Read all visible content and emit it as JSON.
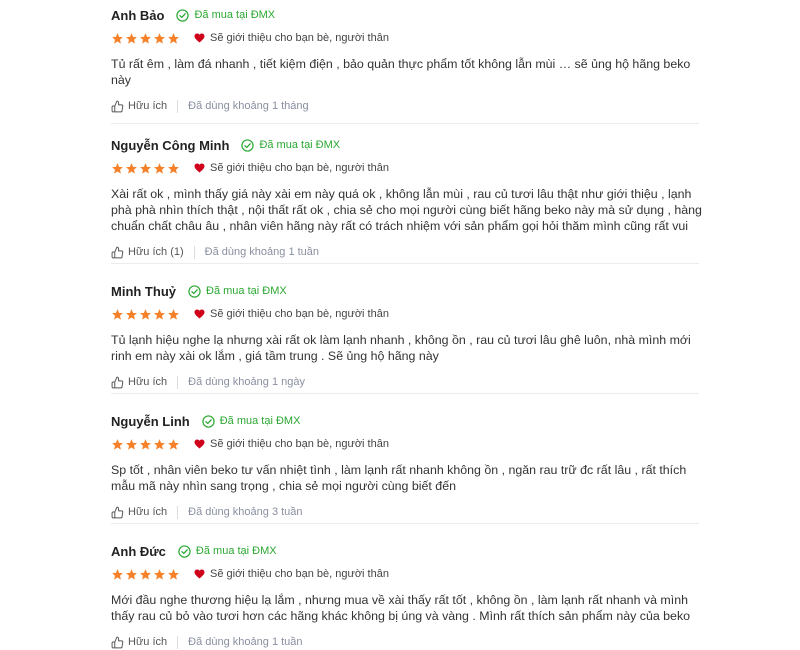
{
  "colors": {
    "star": "#f5822a",
    "heart": "#d0021b",
    "verified": "#2ba832",
    "muted": "#8a8fa0"
  },
  "reviews": [
    {
      "name": "Anh Bảo",
      "verified": "Đã mua tại ĐMX",
      "rating": 5,
      "recommend": "Sẽ giới thiệu cho bạn bè, người thân",
      "lines": [
        "Tủ rất êm , làm đá nhanh , tiết kiệm điện , bảo quản thực phẩm tốt không lẫn mùi … sẽ ủng hộ hãng beko",
        "này"
      ],
      "helpful": "Hữu ích",
      "used": "Đã dùng khoảng 1 tháng"
    },
    {
      "name": "Nguyễn Công Minh",
      "verified": "Đã mua tại ĐMX",
      "rating": 5,
      "recommend": "Sẽ giới thiệu cho bạn bè, người thân",
      "lines": [
        "Xài rất ok , mình thấy giá này xài em này quá ok , không lẫn mùi , rau củ tươi lâu thật như giới thiệu , lạnh",
        "phà phà nhìn thích thật , nội thất rất ok , chia sẻ cho mọi người cùng biết hãng beko này mà sử dụng , hàng",
        "chuẩn chất châu âu , nhân viên hãng này rất có trách nhiệm với sản phẩm gọi hỏi thăm mình cũng rất vui"
      ],
      "helpful": "Hữu ích (1)",
      "used": "Đã dùng khoảng 1 tuần"
    },
    {
      "name": "Minh Thuỷ",
      "verified": "Đã mua tại ĐMX",
      "rating": 5,
      "recommend": "Sẽ giới thiệu cho bạn bè, người thân",
      "lines": [
        "Tủ lạnh hiệu nghe lạ nhưng xài rất ok làm lạnh nhanh , không ồn , rau củ tươi lâu ghê luôn, nhà mình mới",
        "rinh em này xài ok lắm , giá tầm trung . Sẽ ủng hộ hãng này"
      ],
      "helpful": "Hữu ích",
      "used": "Đã dùng khoảng 1 ngày"
    },
    {
      "name": "Nguyễn Linh",
      "verified": "Đã mua tại ĐMX",
      "rating": 5,
      "recommend": "Sẽ giới thiệu cho bạn bè, người thân",
      "lines": [
        "Sp tốt , nhân viên beko tư vấn nhiệt tình , làm lạnh rất nhanh không ồn , ngăn rau trữ đc rất lâu , rất thích",
        "mẫu mã này nhìn sang trọng , chia sẻ mọi người cùng biết đến"
      ],
      "helpful": "Hữu ích",
      "used": "Đã dùng khoảng 3 tuần"
    },
    {
      "name": "Anh Đức",
      "verified": "Đã mua tại ĐMX",
      "rating": 5,
      "recommend": "Sẽ giới thiệu cho bạn bè, người thân",
      "lines": [
        "Mới đầu nghe thương hiệu lạ lắm , nhưng mua về xài thấy rất tốt , không ồn , làm lạnh rất nhanh và mình",
        "thấy rau củ bỏ vào tươi hơn các hãng khác không bị úng và vàng . Mình rất thích sản phẩm này của beko"
      ],
      "helpful": "Hữu ích",
      "used": "Đã dùng khoảng 1 tuần"
    }
  ]
}
